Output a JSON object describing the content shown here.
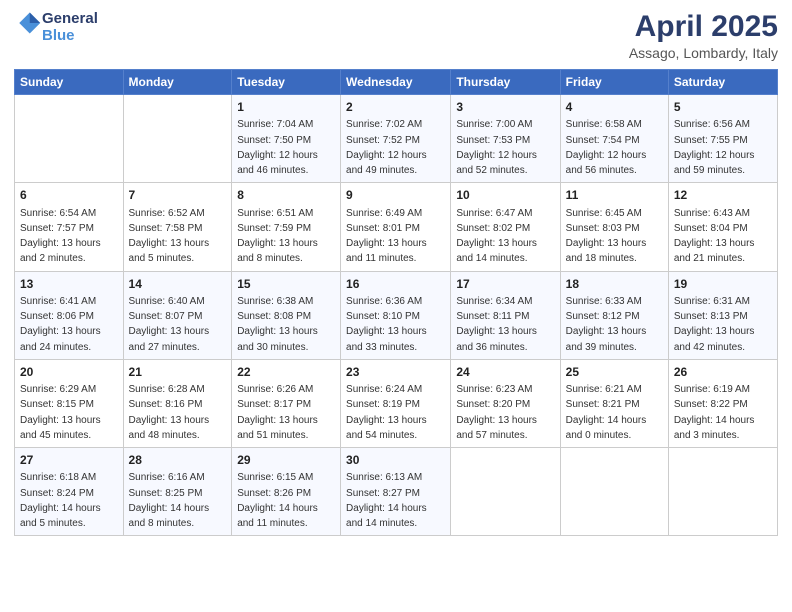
{
  "header": {
    "logo_line1": "General",
    "logo_line2": "Blue",
    "month": "April 2025",
    "location": "Assago, Lombardy, Italy"
  },
  "days_of_week": [
    "Sunday",
    "Monday",
    "Tuesday",
    "Wednesday",
    "Thursday",
    "Friday",
    "Saturday"
  ],
  "weeks": [
    [
      {
        "num": "",
        "info": ""
      },
      {
        "num": "",
        "info": ""
      },
      {
        "num": "1",
        "info": "Sunrise: 7:04 AM\nSunset: 7:50 PM\nDaylight: 12 hours and 46 minutes."
      },
      {
        "num": "2",
        "info": "Sunrise: 7:02 AM\nSunset: 7:52 PM\nDaylight: 12 hours and 49 minutes."
      },
      {
        "num": "3",
        "info": "Sunrise: 7:00 AM\nSunset: 7:53 PM\nDaylight: 12 hours and 52 minutes."
      },
      {
        "num": "4",
        "info": "Sunrise: 6:58 AM\nSunset: 7:54 PM\nDaylight: 12 hours and 56 minutes."
      },
      {
        "num": "5",
        "info": "Sunrise: 6:56 AM\nSunset: 7:55 PM\nDaylight: 12 hours and 59 minutes."
      }
    ],
    [
      {
        "num": "6",
        "info": "Sunrise: 6:54 AM\nSunset: 7:57 PM\nDaylight: 13 hours and 2 minutes."
      },
      {
        "num": "7",
        "info": "Sunrise: 6:52 AM\nSunset: 7:58 PM\nDaylight: 13 hours and 5 minutes."
      },
      {
        "num": "8",
        "info": "Sunrise: 6:51 AM\nSunset: 7:59 PM\nDaylight: 13 hours and 8 minutes."
      },
      {
        "num": "9",
        "info": "Sunrise: 6:49 AM\nSunset: 8:01 PM\nDaylight: 13 hours and 11 minutes."
      },
      {
        "num": "10",
        "info": "Sunrise: 6:47 AM\nSunset: 8:02 PM\nDaylight: 13 hours and 14 minutes."
      },
      {
        "num": "11",
        "info": "Sunrise: 6:45 AM\nSunset: 8:03 PM\nDaylight: 13 hours and 18 minutes."
      },
      {
        "num": "12",
        "info": "Sunrise: 6:43 AM\nSunset: 8:04 PM\nDaylight: 13 hours and 21 minutes."
      }
    ],
    [
      {
        "num": "13",
        "info": "Sunrise: 6:41 AM\nSunset: 8:06 PM\nDaylight: 13 hours and 24 minutes."
      },
      {
        "num": "14",
        "info": "Sunrise: 6:40 AM\nSunset: 8:07 PM\nDaylight: 13 hours and 27 minutes."
      },
      {
        "num": "15",
        "info": "Sunrise: 6:38 AM\nSunset: 8:08 PM\nDaylight: 13 hours and 30 minutes."
      },
      {
        "num": "16",
        "info": "Sunrise: 6:36 AM\nSunset: 8:10 PM\nDaylight: 13 hours and 33 minutes."
      },
      {
        "num": "17",
        "info": "Sunrise: 6:34 AM\nSunset: 8:11 PM\nDaylight: 13 hours and 36 minutes."
      },
      {
        "num": "18",
        "info": "Sunrise: 6:33 AM\nSunset: 8:12 PM\nDaylight: 13 hours and 39 minutes."
      },
      {
        "num": "19",
        "info": "Sunrise: 6:31 AM\nSunset: 8:13 PM\nDaylight: 13 hours and 42 minutes."
      }
    ],
    [
      {
        "num": "20",
        "info": "Sunrise: 6:29 AM\nSunset: 8:15 PM\nDaylight: 13 hours and 45 minutes."
      },
      {
        "num": "21",
        "info": "Sunrise: 6:28 AM\nSunset: 8:16 PM\nDaylight: 13 hours and 48 minutes."
      },
      {
        "num": "22",
        "info": "Sunrise: 6:26 AM\nSunset: 8:17 PM\nDaylight: 13 hours and 51 minutes."
      },
      {
        "num": "23",
        "info": "Sunrise: 6:24 AM\nSunset: 8:19 PM\nDaylight: 13 hours and 54 minutes."
      },
      {
        "num": "24",
        "info": "Sunrise: 6:23 AM\nSunset: 8:20 PM\nDaylight: 13 hours and 57 minutes."
      },
      {
        "num": "25",
        "info": "Sunrise: 6:21 AM\nSunset: 8:21 PM\nDaylight: 14 hours and 0 minutes."
      },
      {
        "num": "26",
        "info": "Sunrise: 6:19 AM\nSunset: 8:22 PM\nDaylight: 14 hours and 3 minutes."
      }
    ],
    [
      {
        "num": "27",
        "info": "Sunrise: 6:18 AM\nSunset: 8:24 PM\nDaylight: 14 hours and 5 minutes."
      },
      {
        "num": "28",
        "info": "Sunrise: 6:16 AM\nSunset: 8:25 PM\nDaylight: 14 hours and 8 minutes."
      },
      {
        "num": "29",
        "info": "Sunrise: 6:15 AM\nSunset: 8:26 PM\nDaylight: 14 hours and 11 minutes."
      },
      {
        "num": "30",
        "info": "Sunrise: 6:13 AM\nSunset: 8:27 PM\nDaylight: 14 hours and 14 minutes."
      },
      {
        "num": "",
        "info": ""
      },
      {
        "num": "",
        "info": ""
      },
      {
        "num": "",
        "info": ""
      }
    ]
  ]
}
